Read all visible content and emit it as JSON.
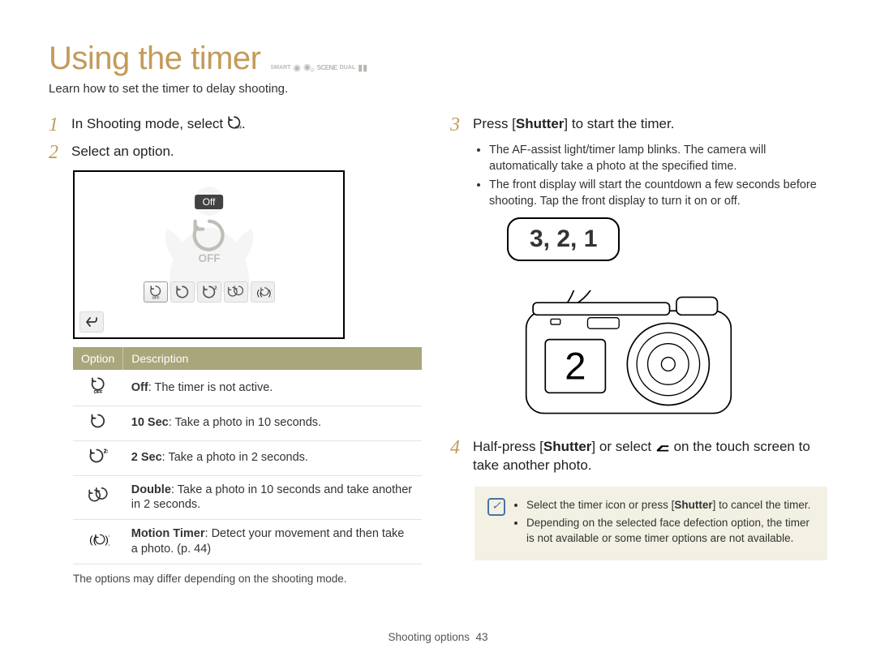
{
  "title": "Using the timer",
  "mode_icons": [
    "SMART",
    "●",
    "●P",
    "SCENE",
    "DUAL",
    "VIDEO"
  ],
  "subtitle": "Learn how to set the timer to delay shooting.",
  "left": {
    "step1_prefix": "In Shooting mode, select ",
    "step1_icon_alt": "timer-off icon",
    "step1_suffix": ".",
    "step2": "Select an option.",
    "screen": {
      "badge": "Off",
      "big_icon_label": "OFF",
      "options": [
        "off",
        "10s",
        "2s",
        "double",
        "motion"
      ],
      "back_alt": "back"
    },
    "table": {
      "head_option": "Option",
      "head_desc": "Description",
      "rows": [
        {
          "icon": "off",
          "bold": "Off",
          "rest": ": The timer is not active."
        },
        {
          "icon": "10s",
          "bold": "10 Sec",
          "rest": ": Take a photo in 10 seconds."
        },
        {
          "icon": "2s",
          "bold": "2 Sec",
          "rest": ": Take a photo in 2 seconds."
        },
        {
          "icon": "double",
          "bold": "Double",
          "rest": ": Take a photo in 10 seconds and take another in 2 seconds."
        },
        {
          "icon": "motion",
          "bold": "Motion Timer",
          "rest": ": Detect your movement and then take a photo. (p. 44)"
        }
      ]
    },
    "note": "The options may differ depending on the shooting mode."
  },
  "right": {
    "step3_prefix": "Press [",
    "step3_bold": "Shutter",
    "step3_suffix": "] to start the timer.",
    "bullets": [
      "The AF-assist light/timer lamp blinks. The camera will automatically take a photo at the specified time.",
      "The front display will start the countdown a few seconds before shooting. Tap the front display to turn it on or off."
    ],
    "bubble": "3, 2, 1",
    "front_display": "2",
    "step4_a": "Half-press [",
    "step4_b": "Shutter",
    "step4_c": "] or select ",
    "step4_icon_alt": "back arrow",
    "step4_d": " on the touch screen to take another photo.",
    "info": [
      {
        "pre": "Select the timer icon or press [",
        "bold": "Shutter",
        "post": "] to cancel the timer."
      },
      {
        "pre": "Depending on the selected face defection option, the timer is not available or some timer options are not available.",
        "bold": "",
        "post": ""
      }
    ]
  },
  "footer_label": "Shooting options",
  "footer_page": "43"
}
